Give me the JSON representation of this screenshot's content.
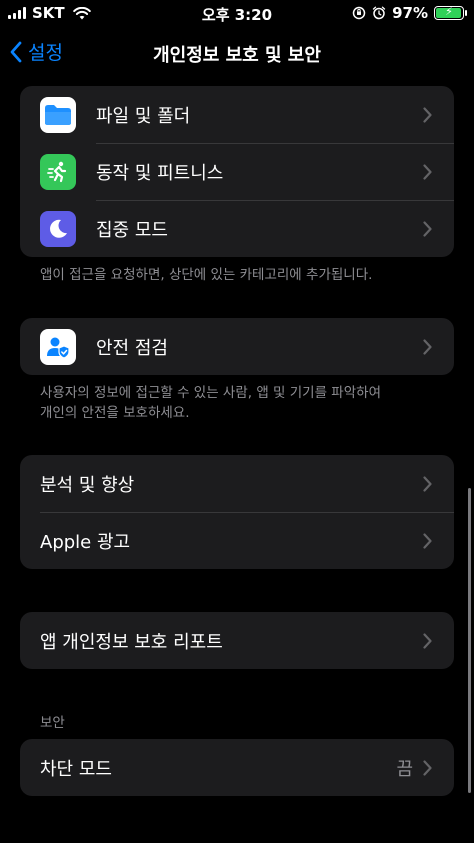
{
  "status": {
    "carrier": "SKT",
    "time": "오후 3:20",
    "battery_percent": "97%",
    "battery_level": 0.97,
    "battery_color": "#30d158"
  },
  "nav": {
    "back_label": "설정",
    "title": "개인정보 보호 및 보안",
    "accent": "#0a84ff"
  },
  "group1": {
    "items": [
      {
        "label": "파일 및 폴더",
        "icon": "folder-icon"
      },
      {
        "label": "동작 및 피트니스",
        "icon": "fitness-runner-icon"
      },
      {
        "label": "집중 모드",
        "icon": "moon-icon"
      }
    ],
    "footer": "앱이 접근을 요청하면, 상단에 있는 카테고리에 추가됩니다."
  },
  "safety": {
    "label": "안전 점검",
    "icon": "person-shield-icon",
    "footer_line1": "사용자의 정보에 접근할 수 있는 사람, 앱 및 기기를 파악하여",
    "footer_line2": "개인의 안전을 보호하세요."
  },
  "analytics": {
    "items": [
      {
        "label": "분석 및 향상"
      },
      {
        "label": "Apple 광고"
      }
    ]
  },
  "report": {
    "label": "앱 개인정보 보호 리포트"
  },
  "security": {
    "header": "보안",
    "lockdown_label": "차단 모드",
    "lockdown_value": "끔"
  }
}
